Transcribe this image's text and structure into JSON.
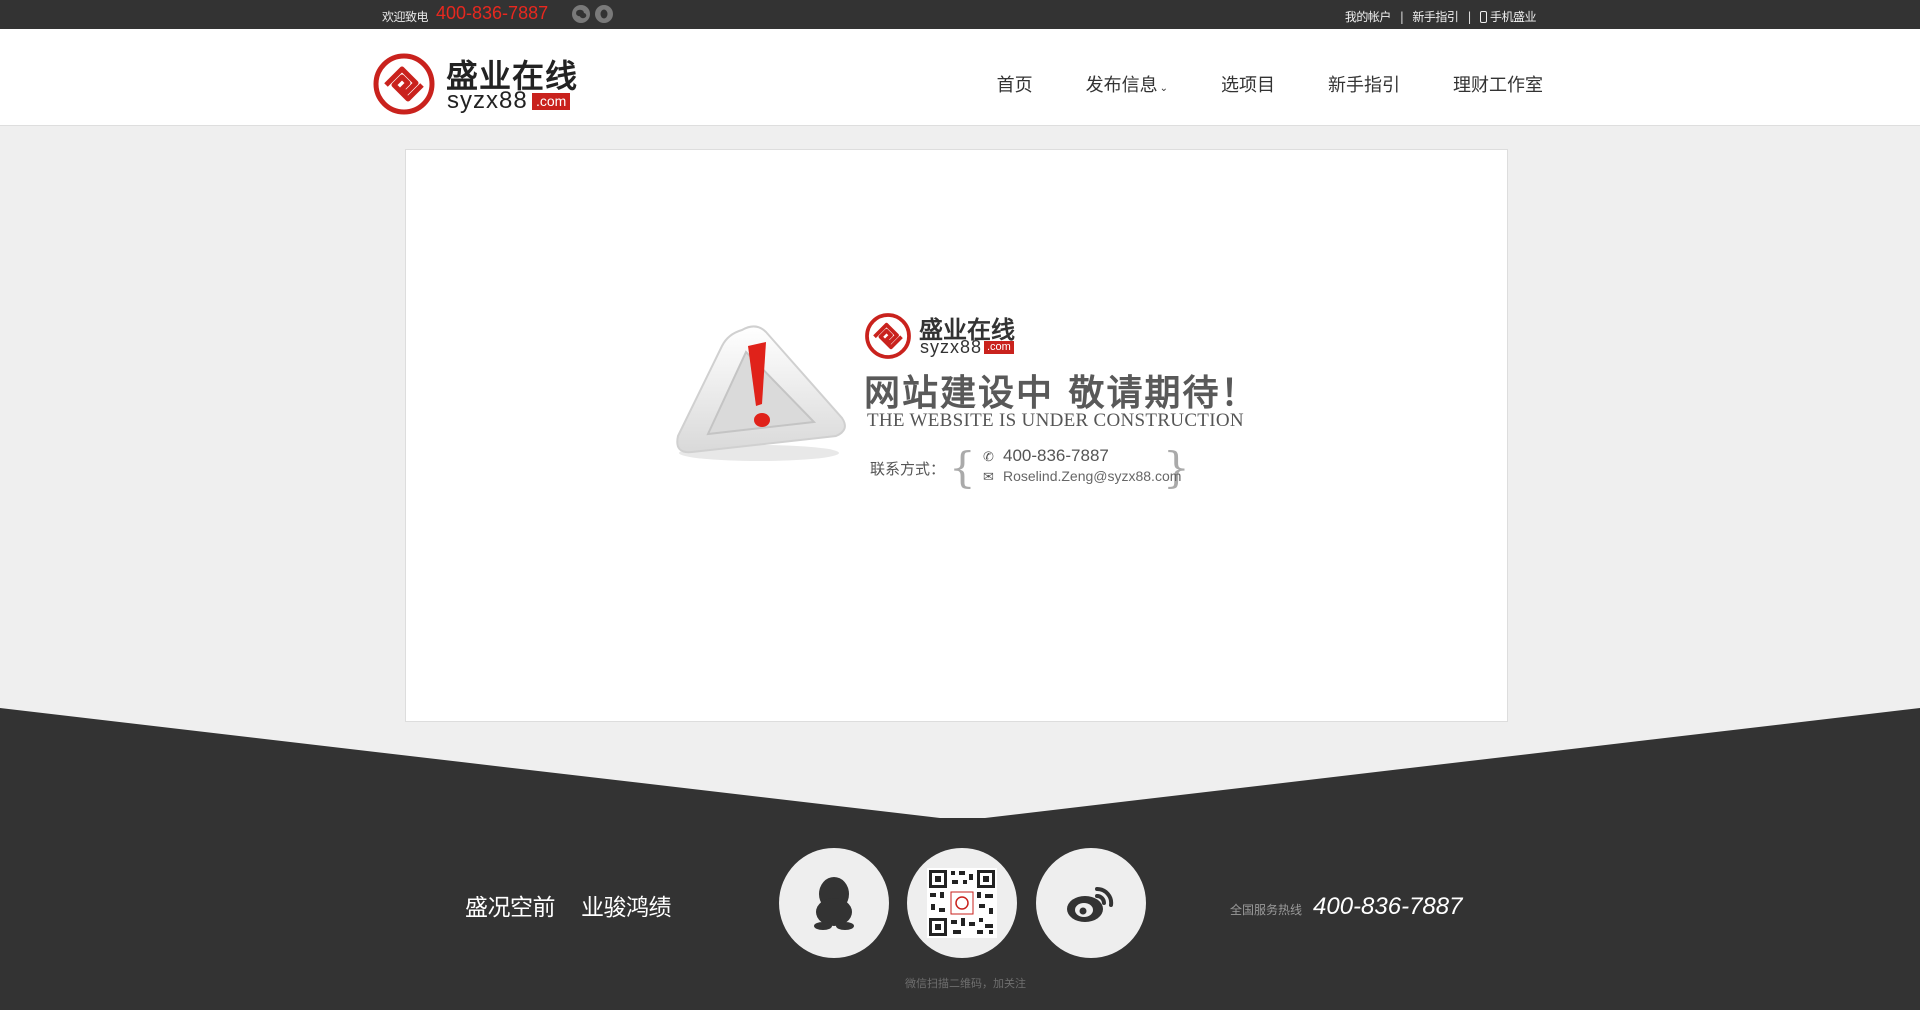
{
  "topbar": {
    "welcome": "欢迎致电",
    "hotline": "400-836-7887",
    "links": [
      "我的帐户",
      "新手指引",
      "手机盛业"
    ]
  },
  "logo": {
    "cn": "盛业在线",
    "en": "syzx88",
    "domain": ".com"
  },
  "nav": {
    "items": [
      "首页",
      "发布信息",
      "选项目",
      "新手指引",
      "理财工作室"
    ],
    "dropdown_caret": "⌄"
  },
  "main": {
    "headline": "网站建设中 敬请期待！",
    "subline": "THE WEBSITE IS UNDER CONSTRUCTION",
    "contact_label": "联系方式：",
    "contact_phone": "400-836-7887",
    "contact_email": "Roselind.Zeng@syzx88.com"
  },
  "footer": {
    "slogan_1": "盛况空前",
    "slogan_2": "业骏鸿绩",
    "qr_caption": "微信扫描二维码，加关注",
    "hotline_label": "全国服务热线",
    "hotline_number": "400-836-7887"
  },
  "colors": {
    "brand_red": "#c9221d",
    "dark": "#333333",
    "hotline_red": "#e8281f"
  },
  "icons": [
    "wechat-icon",
    "qq-icon",
    "phone-icon",
    "warning-icon",
    "mail-icon",
    "qr-code-icon",
    "weibo-icon"
  ]
}
